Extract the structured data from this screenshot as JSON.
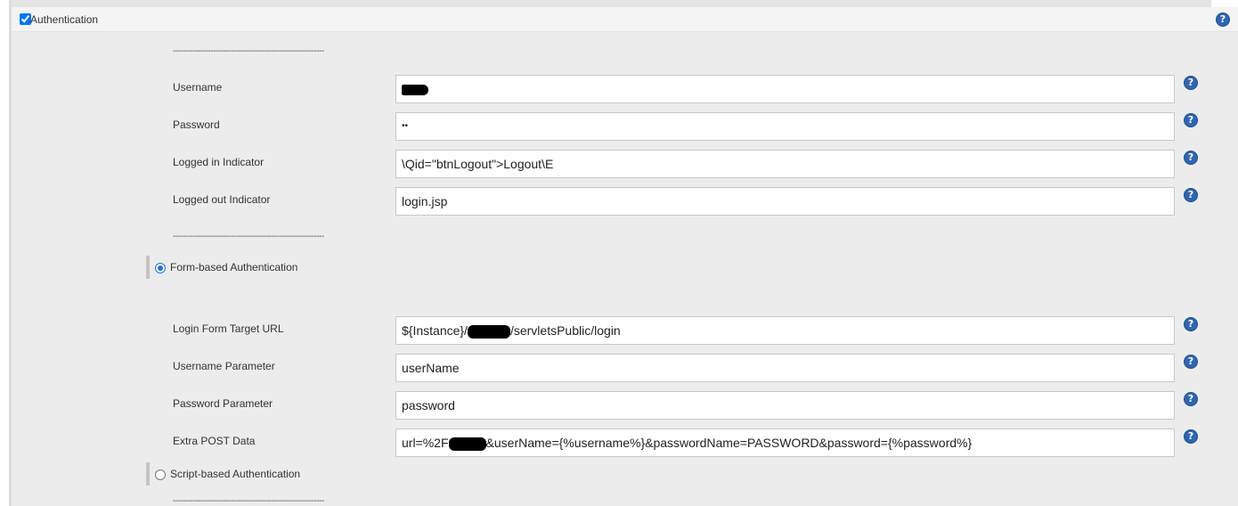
{
  "section": {
    "title": "Authentication",
    "enabled": true,
    "help_icon": "question-circle-icon"
  },
  "separator_text": "------------------------------------------------------------",
  "fields_top": [
    {
      "label": "Username",
      "value": "",
      "redacted": true
    },
    {
      "label": "Password",
      "value": "••"
    },
    {
      "label": "Logged in Indicator",
      "value": "\\Qid=\"btnLogout\">Logout\\E"
    },
    {
      "label": "Logged out Indicator",
      "value": "login.jsp"
    }
  ],
  "auth_methods": [
    {
      "label": "Form-based Authentication",
      "selected": true
    },
    {
      "label": "Script-based Authentication",
      "selected": false
    }
  ],
  "form_fields": {
    "target_url": {
      "label": "Login Form Target URL",
      "prefix": "${Instance}/",
      "suffix": "/servletsPublic/login"
    },
    "username_param": {
      "label": "Username Parameter",
      "value": "userName"
    },
    "password_param": {
      "label": "Password Parameter",
      "value": "password"
    },
    "post_data": {
      "label": "Extra POST Data",
      "prefix": "url=%2F",
      "suffix": "&userName={%username%}&passwordName=PASSWORD&password={%password%}"
    }
  },
  "help_glyph": "?"
}
